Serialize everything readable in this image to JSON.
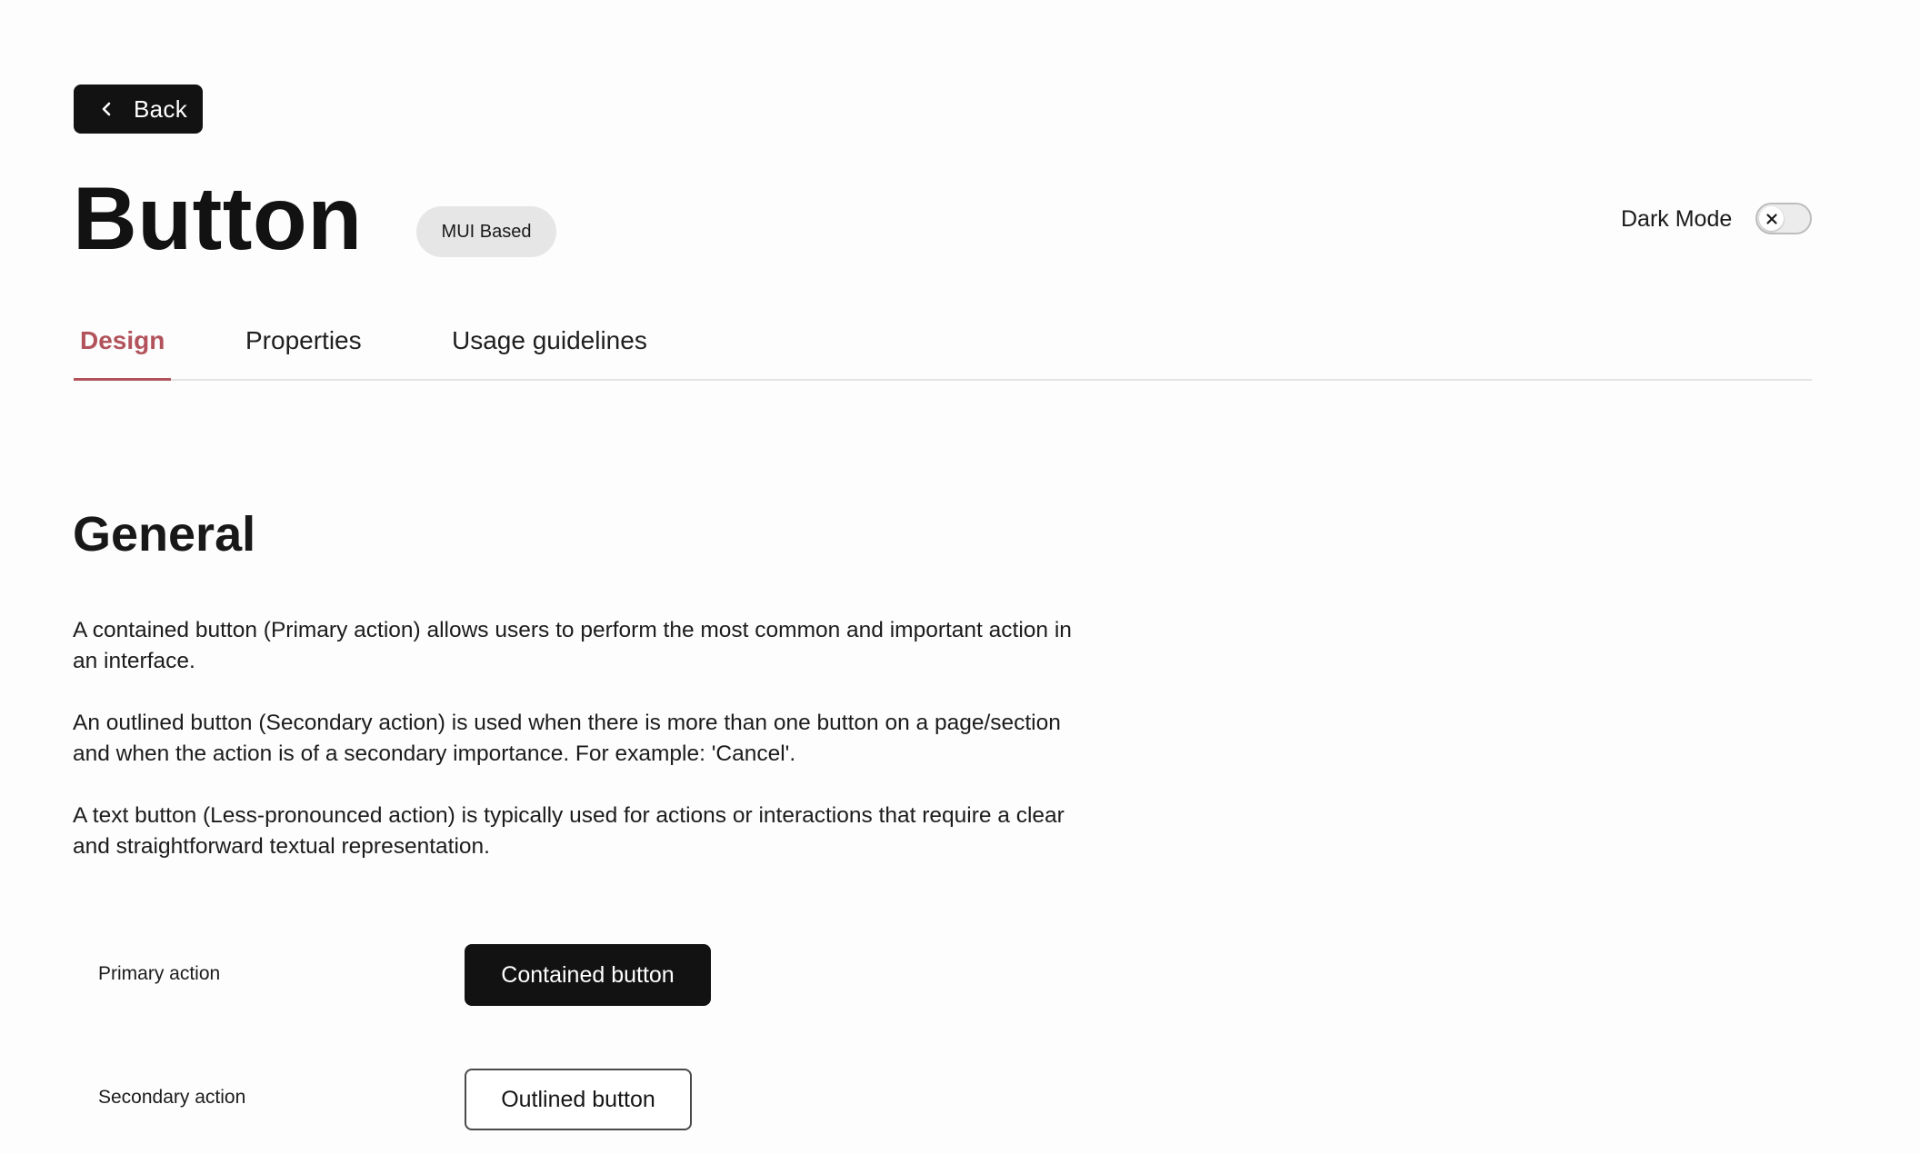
{
  "header": {
    "back_label": "Back",
    "title": "Button",
    "badge": "MUI Based",
    "dark_mode_label": "Dark Mode",
    "dark_mode_on": false
  },
  "tabs": [
    {
      "label": "Design",
      "active": true
    },
    {
      "label": "Properties",
      "active": false
    },
    {
      "label": "Usage guidelines",
      "active": false
    }
  ],
  "section": {
    "title": "General",
    "paragraphs": [
      "A contained button (Primary action) allows users to perform the most common and important action in an interface.",
      "An outlined button (Secondary action) is used when there is more than one button on a page/section and when the action is of a secondary importance. For example: 'Cancel'.",
      "A text button (Less-pronounced action) is typically used for actions or interactions that require a clear and straightforward textual representation."
    ]
  },
  "examples": [
    {
      "label": "Primary action",
      "button": "Contained button"
    },
    {
      "label": "Secondary action",
      "button": "Outlined button"
    }
  ],
  "colors": {
    "accent": "#b2535c",
    "primary_button": "#121212",
    "badge_bg": "#e6e6e6"
  },
  "icons": {
    "back": "chevron-left-icon",
    "toggle": "close-icon"
  }
}
